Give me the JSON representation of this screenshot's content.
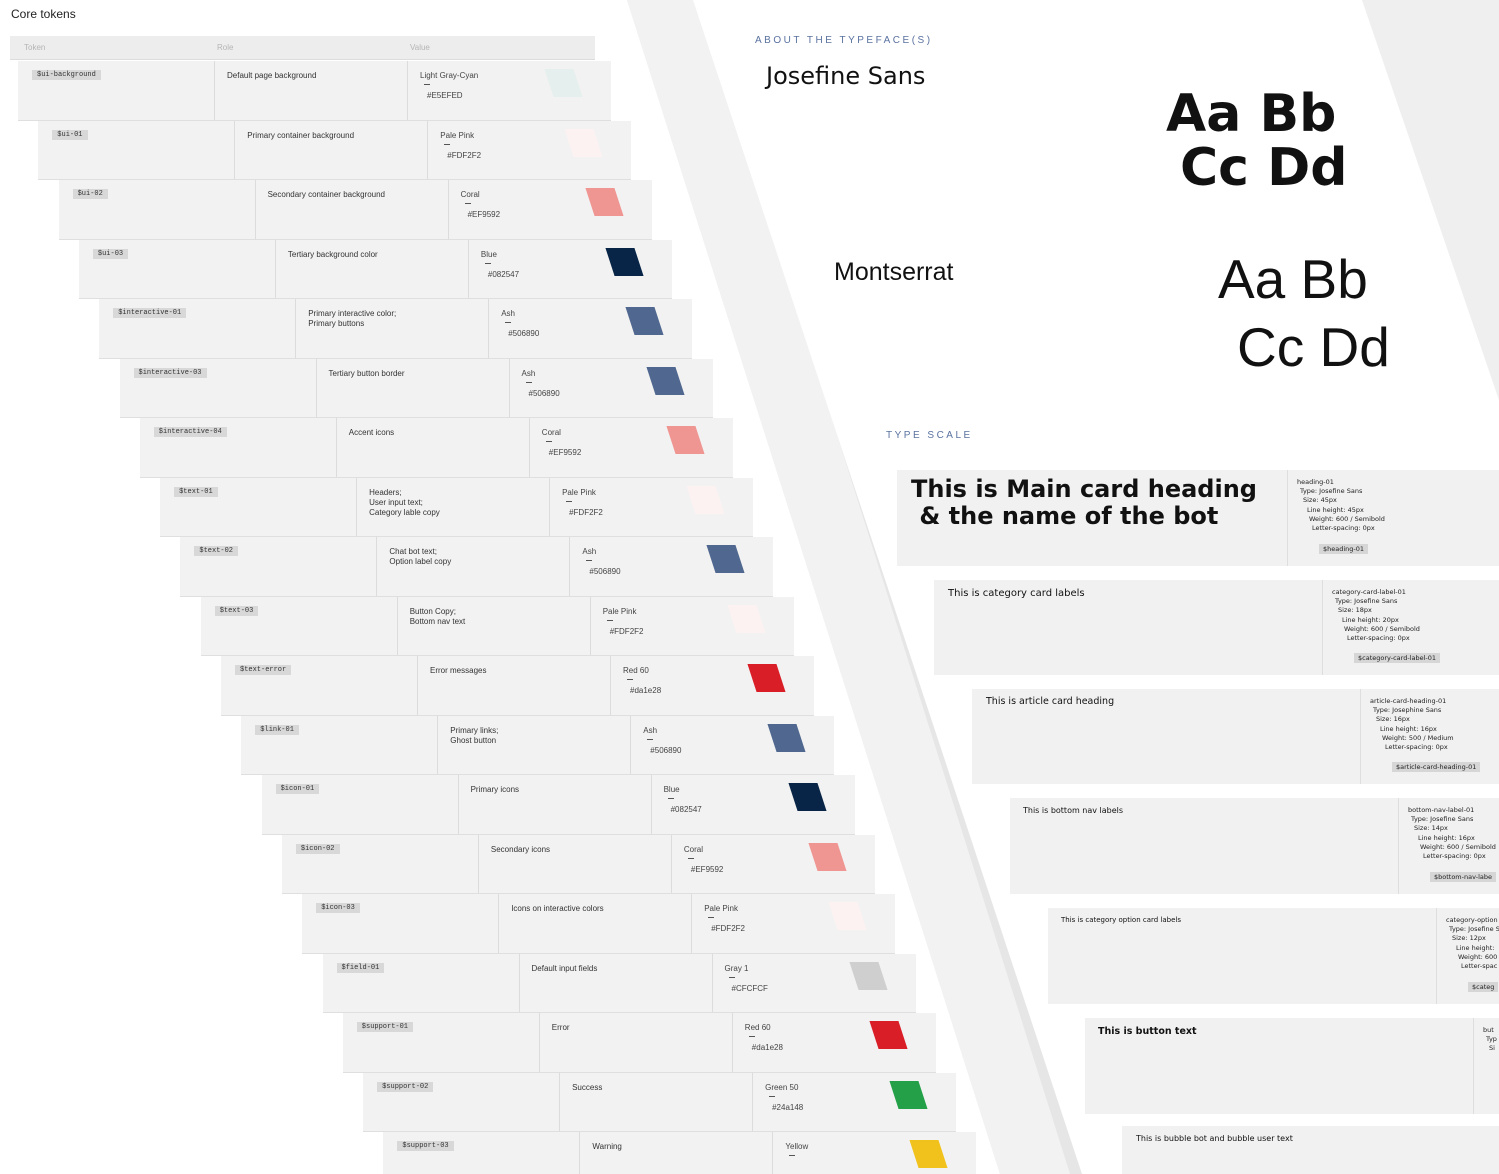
{
  "core_tokens": {
    "title": "Core tokens",
    "headers": {
      "token": "Token",
      "role": "Role",
      "value": "Value"
    },
    "rows": [
      {
        "token": "$ui-background",
        "role": "Default page background",
        "color_name": "Light Gray-Cyan",
        "hex": "#E5EFED",
        "swatch": "#E5EFED"
      },
      {
        "token": "$ui-01",
        "role": "Primary container background",
        "color_name": "Pale Pink",
        "hex": "#FDF2F2",
        "swatch": "#FDF2F2"
      },
      {
        "token": "$ui-02",
        "role": "Secondary container background",
        "color_name": "Coral",
        "hex": "#EF9592",
        "swatch": "#EF9592"
      },
      {
        "token": "$ui-03",
        "role": "Tertiary background color",
        "color_name": "Blue",
        "hex": "#082547",
        "swatch": "#082547"
      },
      {
        "token": "$interactive-01",
        "role": "Primary interactive color;\nPrimary buttons",
        "color_name": "Ash",
        "hex": "#506890",
        "swatch": "#506890"
      },
      {
        "token": "$interactive-03",
        "role": "Tertiary button border",
        "color_name": "Ash",
        "hex": "#506890",
        "swatch": "#506890"
      },
      {
        "token": "$interactive-04",
        "role": "Accent icons",
        "color_name": "Coral",
        "hex": "#EF9592",
        "swatch": "#EF9592"
      },
      {
        "token": "$text-01",
        "role": "Headers;\nUser input text;\nCategory lable copy",
        "color_name": "Pale Pink",
        "hex": "#FDF2F2",
        "swatch": "#FDF2F2"
      },
      {
        "token": "$text-02",
        "role": "Chat bot text;\nOption label copy",
        "color_name": "Ash",
        "hex": "#506890",
        "swatch": "#506890"
      },
      {
        "token": "$text-03",
        "role": "Button Copy;\nBottom nav text",
        "color_name": "Pale Pink",
        "hex": "#FDF2F2",
        "swatch": "#FDF2F2"
      },
      {
        "token": "$text-error",
        "role": "Error messages",
        "color_name": "Red 60",
        "hex": "#da1e28",
        "swatch": "#da1e28"
      },
      {
        "token": "$link-01",
        "role": "Primary links;\nGhost button",
        "color_name": "Ash",
        "hex": "#506890",
        "swatch": "#506890"
      },
      {
        "token": "$icon-01",
        "role": "Primary icons",
        "color_name": "Blue",
        "hex": "#082547",
        "swatch": "#082547"
      },
      {
        "token": "$icon-02",
        "role": "Secondary icons",
        "color_name": "Coral",
        "hex": "#EF9592",
        "swatch": "#EF9592"
      },
      {
        "token": "$icon-03",
        "role": "Icons on interactive colors",
        "color_name": "Pale Pink",
        "hex": "#FDF2F2",
        "swatch": "#FDF2F2"
      },
      {
        "token": "$field-01",
        "role": "Default input fields",
        "color_name": "Gray 1",
        "hex": "#CFCFCF",
        "swatch": "#CFCFCF"
      },
      {
        "token": "$support-01",
        "role": "Error",
        "color_name": "Red 60",
        "hex": "#da1e28",
        "swatch": "#da1e28"
      },
      {
        "token": "$support-02",
        "role": "Success",
        "color_name": "Green 50",
        "hex": "#24a148",
        "swatch": "#24a148"
      },
      {
        "token": "$support-03",
        "role": "Warning",
        "color_name": "Yellow",
        "hex": "",
        "swatch": "#f1c21b"
      }
    ]
  },
  "typefaces": {
    "section_label": "ABOUT THE TYPEFACE(S)",
    "fonts": [
      {
        "name": "Josefine Sans",
        "specimen_line1": "Aa Bb",
        "specimen_line2": "Cc Dd"
      },
      {
        "name": "Montserrat",
        "specimen_line1": "Aa Bb",
        "specimen_line2": "Cc Dd"
      }
    ]
  },
  "type_scale": {
    "section_label": "TYPE SCALE",
    "items": [
      {
        "sample": "This is Main card heading\n & the name of the bot",
        "spec_name": "heading-01",
        "type": "Type: Josefine Sans",
        "size": "Size: 45px",
        "line_height": "Line height: 45px",
        "weight": "Weight: 600 / Semibold",
        "letter_spacing": "Letter-spacing: 0px",
        "token": "$heading-01"
      },
      {
        "sample": "This is category card labels",
        "spec_name": "category-card-label-01",
        "type": "Type: Josefine Sans",
        "size": "Size: 18px",
        "line_height": "Line height: 20px",
        "weight": "Weight: 600 / Semibold",
        "letter_spacing": "Letter-spacing: 0px",
        "token": "$category-card-label-01"
      },
      {
        "sample": "This is article card heading",
        "spec_name": "article-card-heading-01",
        "type": "Type: Josephine Sans",
        "size": "Size: 16px",
        "line_height": "Line height: 16px",
        "weight": "Weight: 500 / Medium",
        "letter_spacing": "Letter-spacing: 0px",
        "token": "$article-card-heading-01"
      },
      {
        "sample": "This is bottom nav labels",
        "spec_name": "bottom-nav-label-01",
        "type": "Type: Josefine Sans",
        "size": "Size: 14px",
        "line_height": "Line height: 16px",
        "weight": "Weight: 600 / Semibold",
        "letter_spacing": "Letter-spacing: 0px",
        "token": "$bottom-nav-labe"
      },
      {
        "sample": "This is category option card labels",
        "spec_name": "category-option",
        "type": "Type: Josefine S",
        "size": "Size: 12px",
        "line_height": "Line height:",
        "weight": "Weight: 600",
        "letter_spacing": "Letter-spac",
        "token": "$categ"
      },
      {
        "sample": "This is button text",
        "spec_name": "but",
        "type": "Typ",
        "size": "Si",
        "line_height": "",
        "weight": "",
        "letter_spacing": "",
        "token": ""
      },
      {
        "sample": "This is bubble bot and bubble user text",
        "spec_name": "",
        "type": "",
        "size": "",
        "line_height": "",
        "weight": "",
        "letter_spacing": "",
        "token": ""
      }
    ]
  }
}
